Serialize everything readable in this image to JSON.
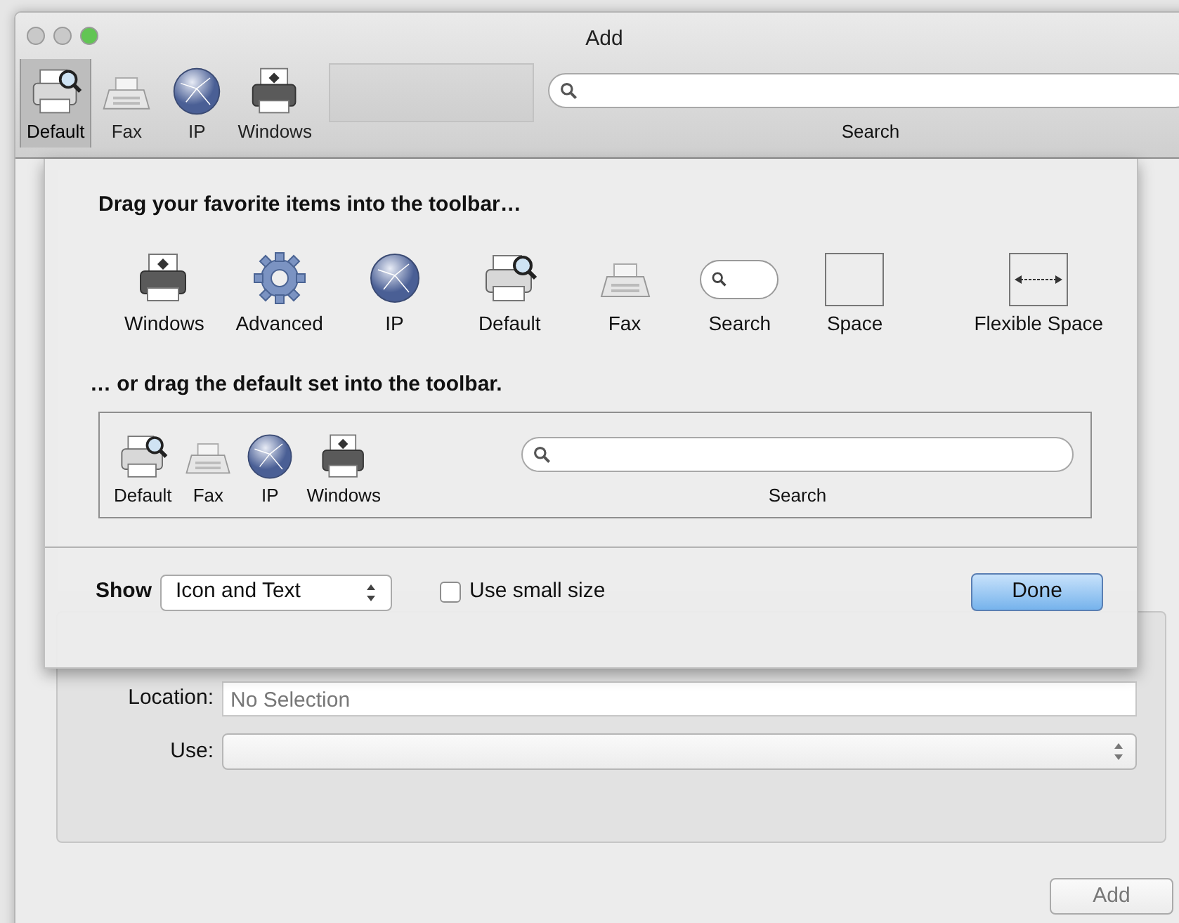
{
  "window": {
    "title": "Add",
    "controls": [
      {
        "color": "#c9c9c9"
      },
      {
        "color": "#c9c9c9"
      },
      {
        "color": "#62c554"
      }
    ]
  },
  "toolbar": {
    "items": [
      {
        "kind": "default",
        "label": "Default",
        "selected": true
      },
      {
        "kind": "fax",
        "label": "Fax",
        "selected": false
      },
      {
        "kind": "ip",
        "label": "IP",
        "selected": false
      },
      {
        "kind": "windows",
        "label": "Windows",
        "selected": false
      }
    ],
    "search_label": "Search"
  },
  "details": {
    "fields": [
      {
        "kind": "text",
        "label": "Location:",
        "value": "No Selection"
      },
      {
        "kind": "select",
        "label": "Use:"
      }
    ]
  },
  "add_button": {
    "label": "Add",
    "disabled": true
  },
  "customize_sheet": {
    "palette_heading": "Drag your favorite items into the toolbar…",
    "palette": [
      {
        "kind": "windows",
        "label": "Windows"
      },
      {
        "kind": "advanced",
        "label": "Advanced"
      },
      {
        "kind": "ip",
        "label": "IP"
      },
      {
        "kind": "default",
        "label": "Default"
      },
      {
        "kind": "fax",
        "label": "Fax"
      },
      {
        "kind": "search",
        "label": "Search"
      },
      {
        "kind": "space",
        "label": "Space"
      },
      {
        "kind": "flexible_space",
        "label": "Flexible Space"
      }
    ],
    "default_set_heading": "… or drag the default set into the toolbar.",
    "default_set": [
      {
        "kind": "default",
        "label": "Default"
      },
      {
        "kind": "fax",
        "label": "Fax"
      },
      {
        "kind": "ip",
        "label": "IP"
      },
      {
        "kind": "windows",
        "label": "Windows"
      },
      {
        "kind": "searchfield",
        "label": "Search"
      }
    ],
    "show_label": "Show",
    "show_value": "Icon and Text",
    "small_size": {
      "label": "Use small size",
      "checked": false
    },
    "done_button": "Done"
  }
}
